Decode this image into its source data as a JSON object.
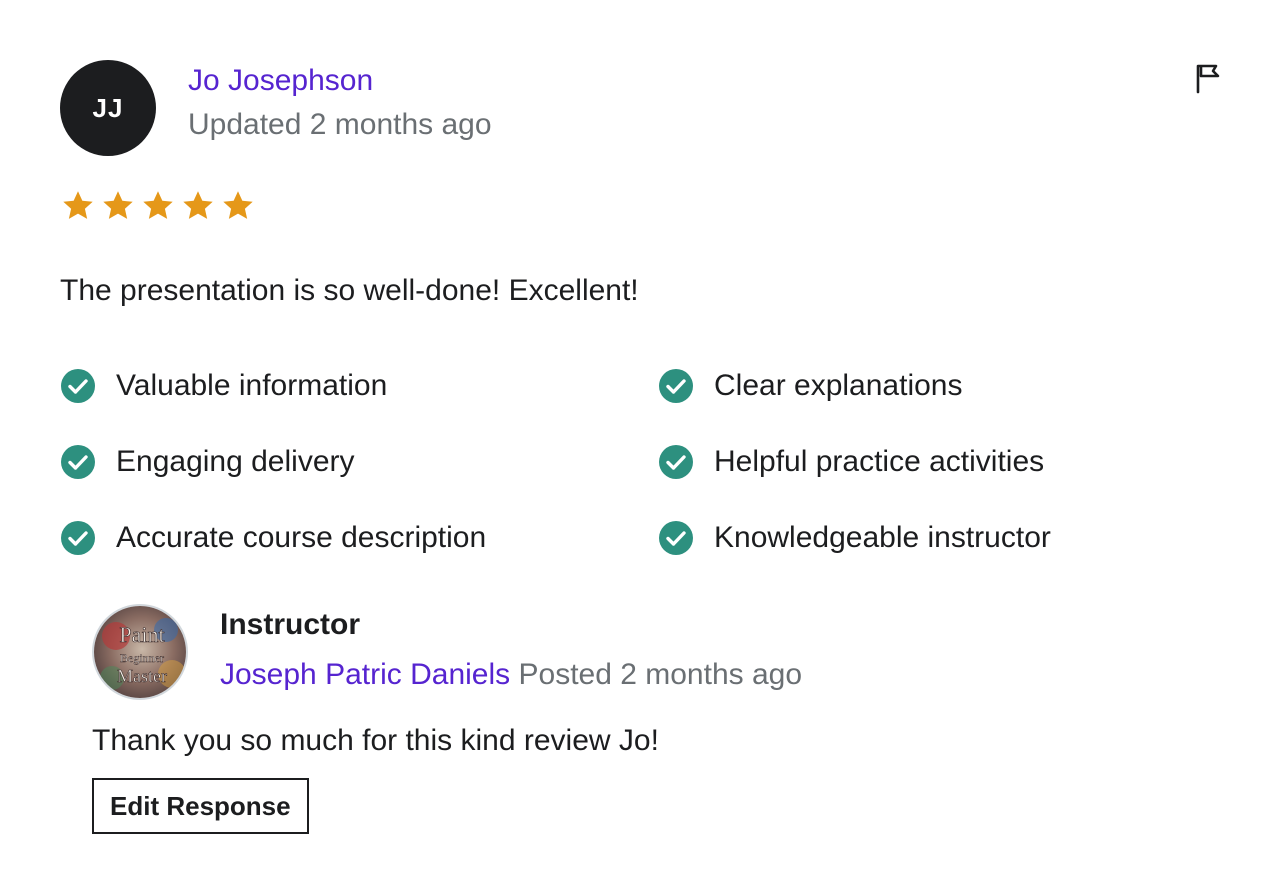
{
  "reviewer": {
    "initials": "JJ",
    "name": "Jo Josephson",
    "updated": "Updated 2 months ago"
  },
  "rating": {
    "value": 5,
    "max": 5
  },
  "review_text": "The presentation is so well-done! Excellent!",
  "tags": [
    "Valuable information",
    "Clear explanations",
    "Engaging delivery",
    "Helpful practice activities",
    "Accurate course description",
    "Knowledgeable instructor"
  ],
  "response": {
    "role": "Instructor",
    "avatar_text": [
      "Paint",
      "Beginner",
      "Master"
    ],
    "name": "Joseph Patric Daniels",
    "posted": "Posted 2 months ago",
    "text": "Thank you so much for this kind review Jo!",
    "edit_label": "Edit Response"
  },
  "icons": {
    "flag": "flag-icon",
    "star": "star-icon",
    "check": "check-circle-icon"
  },
  "colors": {
    "link": "#5624d0",
    "muted": "#6a6f73",
    "star": "#e59819",
    "check": "#2d907f",
    "text": "#1c1d1f"
  }
}
